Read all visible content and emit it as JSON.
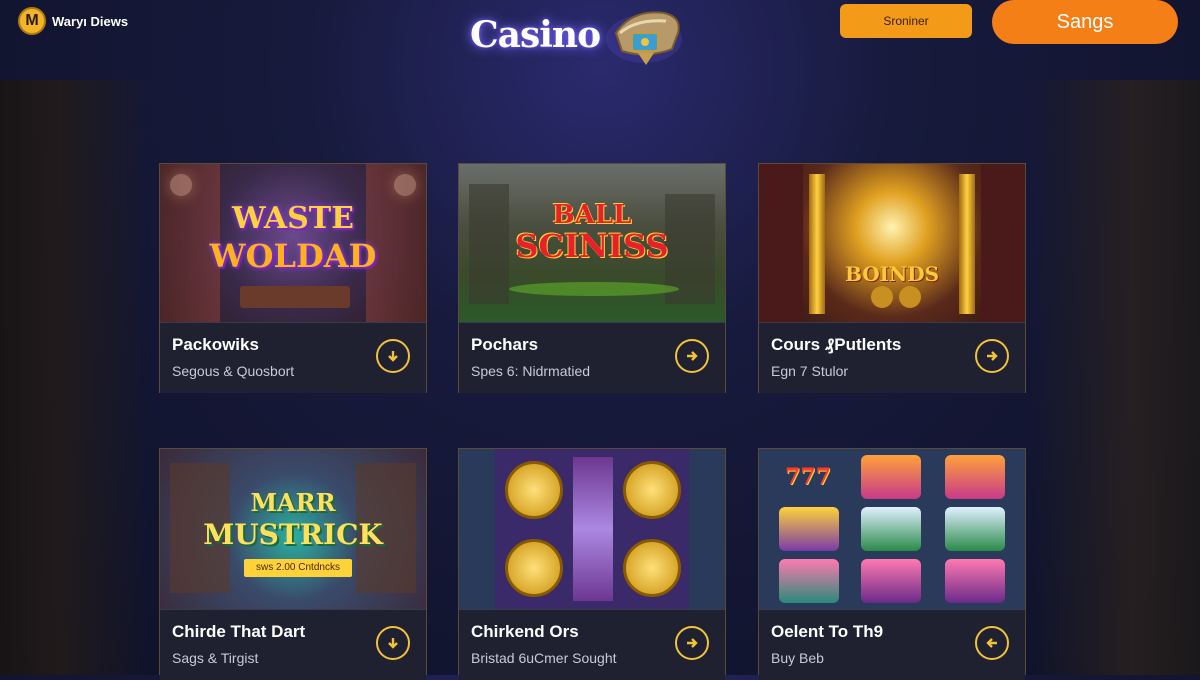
{
  "header": {
    "brand_name": "Waryı Diews",
    "brand_logo_letter": "M",
    "title": "Casino",
    "signin_label": "Sroniner",
    "signup_label": "Sangs"
  },
  "colors": {
    "accent_orange": "#f57f17",
    "button_orange": "#f39a18",
    "icon_gold": "#f2c23a",
    "background_navy": "#171a3c"
  },
  "games": [
    {
      "art_title_1": "WASTE",
      "art_title_2": "WOLDAD",
      "title": "Packowiks",
      "subtitle": "Segous & Quosbort",
      "action_icon": "arrow-down-icon"
    },
    {
      "art_title_1": "BALL",
      "art_title_2": "SCINISS",
      "title": "Pochars",
      "subtitle": "Spes 6: Nidrmatied",
      "action_icon": "arrow-right-icon"
    },
    {
      "art_title_1": "BOINDS",
      "title": "Cours ₰Putlents",
      "subtitle": "Egn 7 Stulor",
      "action_icon": "arrow-right-icon"
    },
    {
      "art_title_1": "MARR",
      "art_title_2": "MUSTRICK",
      "art_banner": "sws 2.00 Cntdncks",
      "title": "Chirde That Dart",
      "subtitle": "Sags & Tirgist",
      "action_icon": "arrow-down-icon"
    },
    {
      "title": "Chirkend Ors",
      "subtitle": "Bristad 6uCmer Sought",
      "action_icon": "arrow-right-icon"
    },
    {
      "art_title_1": "777",
      "title": "Oelent To Th9",
      "subtitle": "Buy Beb",
      "action_icon": "arrow-left-icon"
    }
  ]
}
